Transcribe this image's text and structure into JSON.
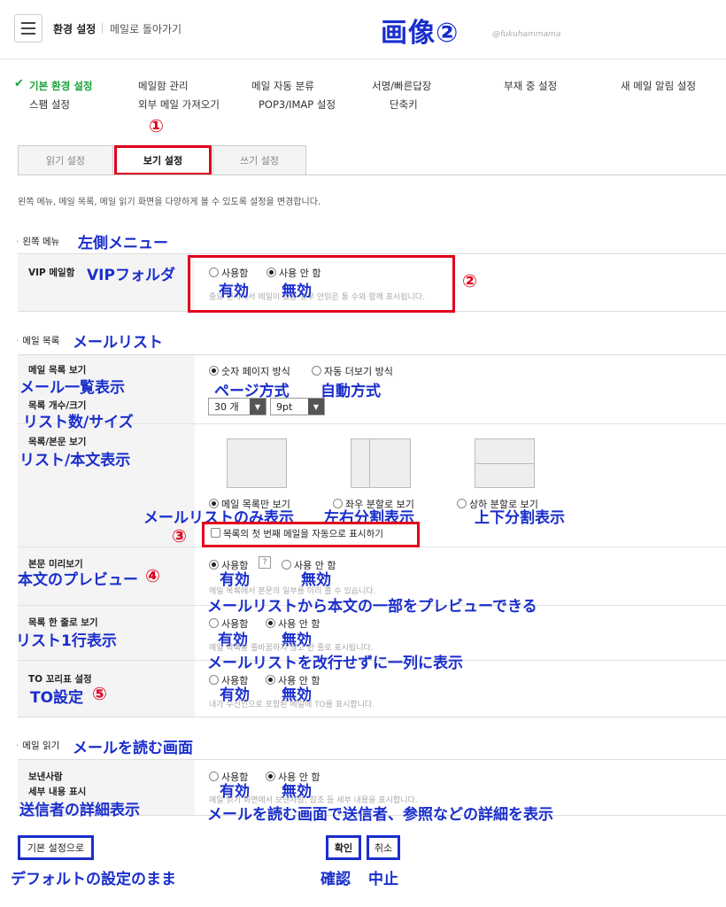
{
  "header": {
    "title": "환경 설정",
    "back_link": "메일로 돌아가기",
    "overlay_title": "画像②",
    "watermark": "@fukuhammama"
  },
  "nav": {
    "row1": [
      "기본 환경 설정",
      "메일함 관리",
      "메일 자동 분류",
      "서명/빠른답장",
      "부재 중 설정",
      "새 메일 알림 설정"
    ],
    "row2": [
      "스팸 설정",
      "외부 메일 가져오기",
      "POP3/IMAP 설정",
      "단축키"
    ]
  },
  "tabs": [
    "읽기 설정",
    "보기 설정",
    "쓰기 설정"
  ],
  "description": "왼쪽 메뉴, 메일 목록, 메일 읽기 화면을 다양하게 볼 수 있도록 설정을 변경합니다.",
  "sections": {
    "left_menu": {
      "title": "왼쪽 메뉴",
      "jp": "左側メニュー"
    },
    "mail_list": {
      "title": "메일 목록",
      "jp": "メールリスト"
    },
    "mail_read": {
      "title": "메일 읽기",
      "jp": "メールを読む画面"
    }
  },
  "vip": {
    "label": "VIP 메일함",
    "label_jp": "VIPフォルダ",
    "opt_on": "사용함",
    "opt_off": "사용 안 함",
    "hint": "중요 편지에서 메일이 있을 경우 안읽은 통 수와 함께 표시됩니다.",
    "jp_on": "有効",
    "jp_off": "無効"
  },
  "list_view": {
    "label": "메일 목록 보기",
    "label_jp": "メール一覧表示",
    "opt_page": "숫자 페이지 방식",
    "opt_auto": "자동 더보기 방식",
    "jp_page": "ページ方式",
    "jp_auto": "自動方式"
  },
  "list_size": {
    "label": "목록 개수/크기",
    "label_jp": "リスト数/サイズ",
    "count": "30 개",
    "font": "9pt"
  },
  "list_body": {
    "label": "목록/본문 보기",
    "label_jp": "リスト/本文表示",
    "opt_list": "메일 목록만 보기",
    "opt_lr": "좌우 분할로 보기",
    "opt_tb": "상하 분할로 보기",
    "jp_list": "メールリストのみ表示",
    "jp_lr": "左右分割表示",
    "jp_tb": "上下分割表示",
    "auto_first": "목록의 첫 번째 메일을 자동으로 표시하기"
  },
  "preview": {
    "label": "본문 미리보기",
    "label_jp": "本文のプレビュー",
    "opt_on": "사용함",
    "opt_off": "사용 안 함",
    "q": "?",
    "hint": "메일 목록에서 본문의 일부를 미리 볼 수 있습니다.",
    "jp_on": "有効",
    "jp_off": "無効",
    "jp_note": "メールリストから本文の一部をプレビューできる"
  },
  "oneline": {
    "label": "목록 한 줄로 보기",
    "label_jp": "リスト1行表示",
    "opt_on": "사용함",
    "opt_off": "사용 안 함",
    "hint": "메일 목록을 줄바꿈하지 않고 한 줄로 표시됩니다.",
    "jp_on": "有効",
    "jp_off": "無効",
    "jp_note": "メールリストを改行せずに一列に表示"
  },
  "to_tag": {
    "label": "TO 꼬리표 설정",
    "label_jp": "TO設定",
    "opt_on": "사용함",
    "opt_off": "사용 안 함",
    "hint": "내가 수신인으로 포함된 메일에 TO를 표시합니다.",
    "jp_on": "有効",
    "jp_off": "無効"
  },
  "sender": {
    "label1": "보낸사람",
    "label2": "세부 내용 표시",
    "label_jp": "送信者の詳細表示",
    "opt_on": "사용함",
    "opt_off": "사용 안 함",
    "hint": "메일 읽기 화면에서 보낸사람, 참조 등 세부 내용을 표시합니다.",
    "jp_on": "有効",
    "jp_off": "無効",
    "jp_note": "メールを読む画面で送信者、参照などの詳細を表示"
  },
  "buttons": {
    "default": "기본 설정으로",
    "confirm": "확인",
    "cancel": "취소",
    "default_jp": "デフォルトの設定のまま",
    "confirm_jp": "確認",
    "cancel_jp": "中止"
  },
  "markers": [
    "①",
    "②",
    "③",
    "④",
    "⑤"
  ],
  "colors": {
    "accent_green": "#18a43b",
    "annot_red": "#e0001b",
    "annot_blue": "#1a2ecc"
  }
}
